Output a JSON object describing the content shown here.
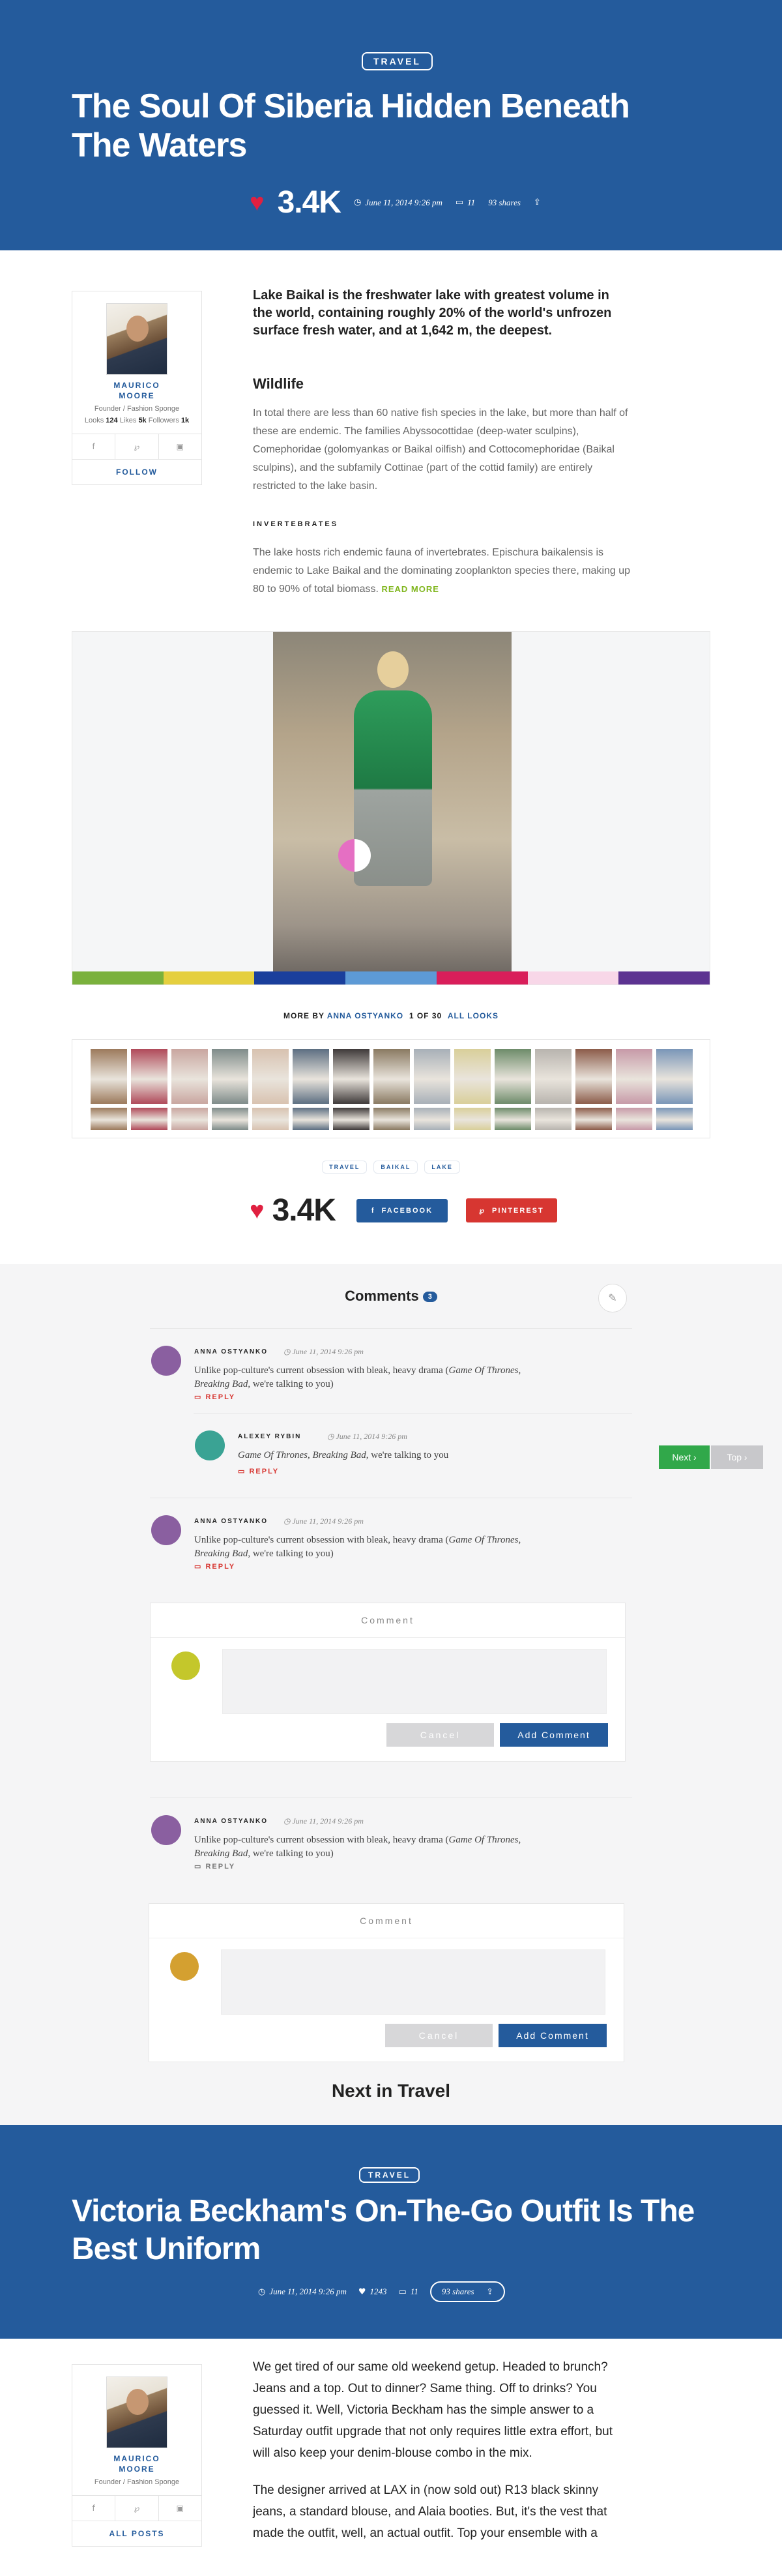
{
  "article": {
    "tag": "TRAVEL",
    "title": "The Soul Of Siberia Hidden Beneath The Waters",
    "likes": "3.4K",
    "date": "June 11, 2014 9:26 pm",
    "comments_count": "11",
    "shares": "93 shares",
    "lead": "Lake Baikal is the freshwater lake with greatest volume in the world, containing roughly 20% of the world's unfrozen surface fresh water, and at 1,642 m, the deepest.",
    "section_title": "Wildlife",
    "section_text": "In total there are less than 60 native fish species in the lake, but more than half of these are endemic. The families Abyssocottidae (deep-water sculpins), Comephoridae (golomyankas or Baikal oilfish) and Cottocomephoridae (Baikal sculpins), and the subfamily Cottinae (part of the cottid family) are entirely restricted to the lake basin.",
    "subheading": "INVERTEBRATES",
    "sub_text": "The lake hosts rich endemic fauna of invertebrates. Epischura baikalensis is endemic to Lake Baikal and the dominating zooplankton species there, making up 80 to 90% of total biomass.",
    "read_more": "READ MORE"
  },
  "author": {
    "name_line1": "MAURICO",
    "name_line2": "MOORE",
    "role": "Founder / Fashion Sponge",
    "looks_label": "Looks",
    "looks": "124",
    "likes_label": "Likes",
    "likes": "5k",
    "followers_label": "Followers",
    "followers": "1k",
    "follow": "FOLLOW"
  },
  "gallery": {
    "colors": [
      "#7ab13c",
      "#e5cf3f",
      "#1a3f9c",
      "#5d9ad6",
      "#d91e5a",
      "#f8d7e8",
      "#5c3391"
    ],
    "more_by": "MORE BY",
    "more_author": "ANNA OSTYANKO",
    "position": "1 OF 30",
    "all_looks": "ALL LOOKS"
  },
  "tags": [
    "TRAVEL",
    "BAIKAL",
    "LAKE"
  ],
  "share": {
    "likes": "3.4K",
    "facebook": "FACEBOOK",
    "pinterest": "PINTEREST"
  },
  "comments": {
    "title": "Comments",
    "count": "3",
    "items": [
      {
        "name": "ANNA OSTYANKO",
        "date": "June 11, 2014 9:26 pm",
        "text_a": "Unlike pop-culture's current obsession with bleak, heavy drama (",
        "text_i": "Game Of Thrones, Breaking Bad",
        "text_b": ", we're talking to you)",
        "reply": "REPLY"
      },
      {
        "name": "ALEXEY RYBIN",
        "date": "June 11, 2014 9:26 pm",
        "text_i": "Game Of Thrones, Breaking Bad",
        "text_b": ", we're talking to you",
        "reply": "REPLY"
      },
      {
        "name": "ANNA OSTYANKO",
        "date": "June 11, 2014 9:26 pm",
        "text_a": "Unlike pop-culture's current obsession with bleak, heavy drama (",
        "text_i": "Game Of Thrones, Breaking Bad",
        "text_b": ", we're talking to you)",
        "reply": "REPLY"
      },
      {
        "name": "ANNA OSTYANKO",
        "date": "June 11, 2014 9:26 pm",
        "text_a": "Unlike pop-culture's current obsession with bleak, heavy drama (",
        "text_i": "Game Of Thrones, Breaking Bad",
        "text_b": ", we're talking to you)",
        "reply": "REPLY"
      }
    ],
    "box_label": "Comment",
    "cancel": "Cancel",
    "add": "Add Comment"
  },
  "pager": {
    "next": "Next ›",
    "top": "Top ›"
  },
  "next_in": "Next in Travel",
  "next_article": {
    "tag": "TRAVEL",
    "title": "Victoria Beckham's On-The-Go Outfit Is The Best Uniform",
    "date": "June 11, 2014 9:26 pm",
    "likes": "1243",
    "comments": "11",
    "shares": "93 shares",
    "author_line1": "MAURICO",
    "author_line2": "MOORE",
    "author_role": "Founder / Fashion Sponge",
    "all_posts": "ALL POSTS",
    "para1": "We get tired of our same old weekend getup. Headed to brunch? Jeans and a top. Out to dinner? Same thing. Off to drinks? You guessed it. Well, Victoria Beckham has the simple answer to a Saturday outfit upgrade that not only requires little extra effort, but will also keep your denim-blouse combo in the mix.",
    "para2": "The designer arrived at LAX in (now sold out) R13 black skinny jeans, a standard blouse, and Alaia booties. But, it's the vest that made the outfit, well, an actual outfit. Top your ensemble with a"
  }
}
